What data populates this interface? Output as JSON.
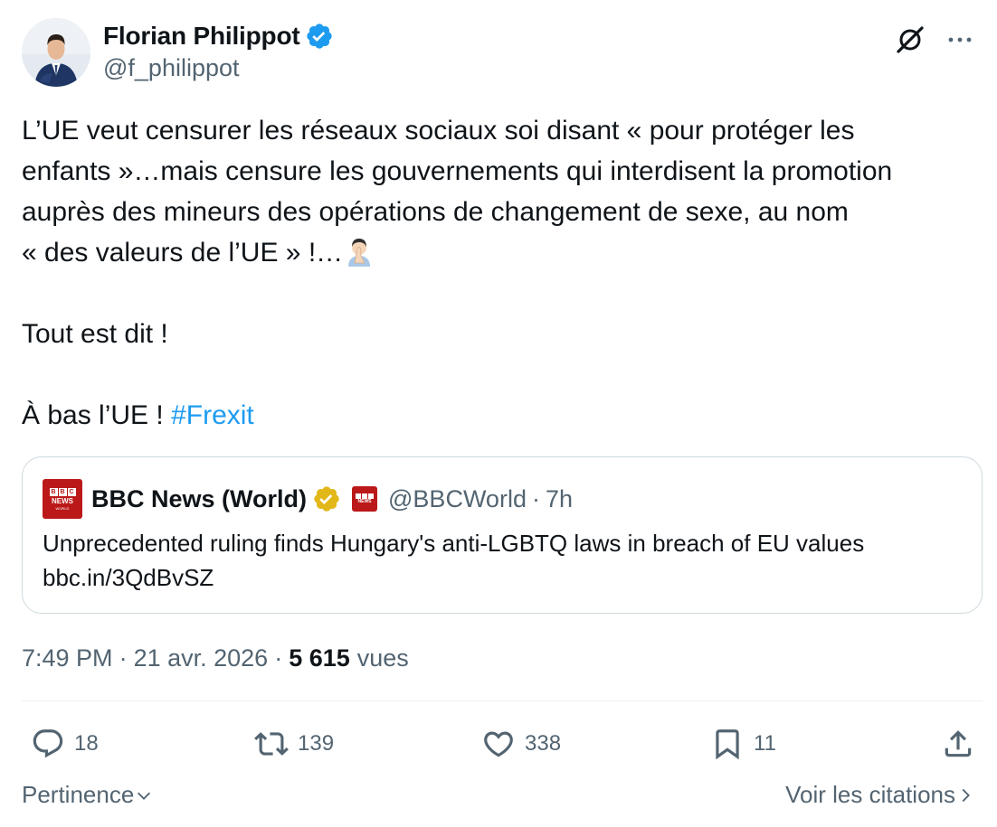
{
  "author": {
    "name": "Florian Philippot",
    "handle": "@f_philippot",
    "verified_color": "#1d9bf0"
  },
  "post": {
    "line1": "L’UE veut censurer les réseaux sociaux soi disant « pour protéger les",
    "line2": "enfants »…mais censure les gouvernements qui interdisent la promotion",
    "line3": "auprès des mineurs des opérations de changement de sexe, au nom",
    "line4": "« des valeurs de l’UE » !…",
    "emoji": "face-palm-emoji",
    "line5": "Tout est dit !",
    "line6": "À bas l’UE ! ",
    "hashtag": "#Frexit"
  },
  "quote": {
    "name": "BBC News (World)",
    "handle": "@BBCWorld",
    "separator": "·",
    "time": "7h",
    "text": "Unprecedented ruling finds Hungary's anti-LGBTQ laws in breach of EU values",
    "link": "bbc.in/3QdBvSZ",
    "logo_text": "NEWS",
    "logo_letters": [
      "B",
      "B",
      "C"
    ],
    "logo_sub": "WORLD",
    "brand_color": "#bb1919",
    "badge_color": "#e2b719"
  },
  "meta": {
    "time": "7:49 PM",
    "sep": "·",
    "date": "21 avr. 2026",
    "views_count": "5 615",
    "views_label": "vues"
  },
  "actions": {
    "replies": "18",
    "reposts": "139",
    "likes": "338",
    "bookmarks": "11"
  },
  "footer": {
    "sort_label": "Pertinence",
    "quotes_label": "Voir les citations"
  },
  "colors": {
    "text": "#0f1419",
    "secondary": "#536471",
    "link": "#1d9bf0",
    "border": "#cfd9de"
  }
}
